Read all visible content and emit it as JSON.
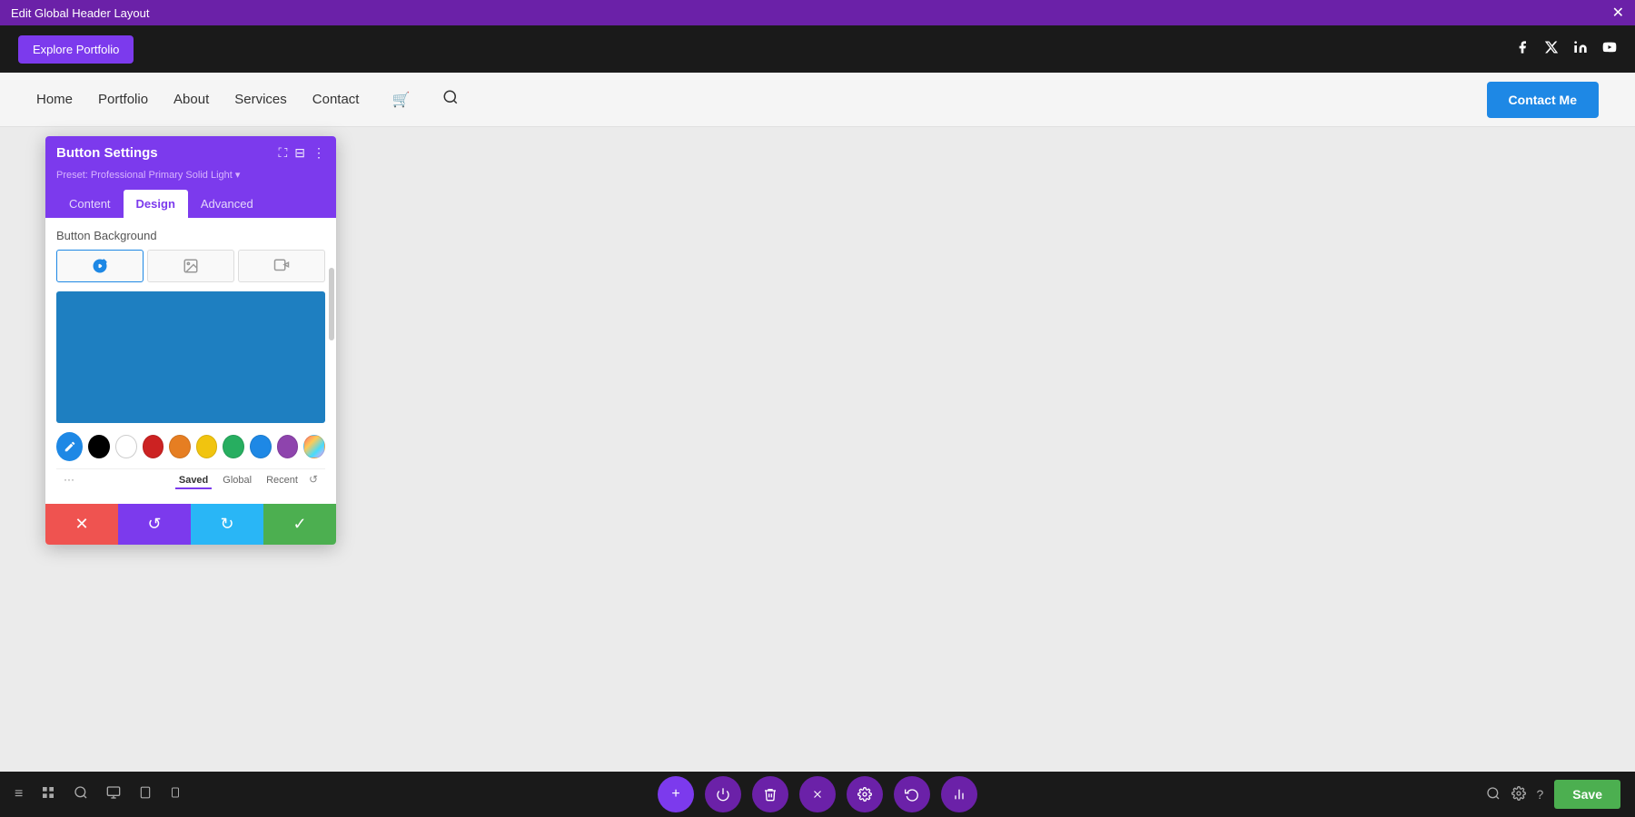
{
  "topBar": {
    "title": "Edit Global Header Layout",
    "closeIcon": "✕"
  },
  "header": {
    "exploreBtn": "Explore Portfolio",
    "socialIcons": [
      {
        "name": "facebook-icon",
        "symbol": "f"
      },
      {
        "name": "twitter-x-icon",
        "symbol": "𝕏"
      },
      {
        "name": "linkedin-icon",
        "symbol": "in"
      },
      {
        "name": "youtube-icon",
        "symbol": "▶"
      }
    ]
  },
  "nav": {
    "links": [
      "Home",
      "Portfolio",
      "About",
      "Services",
      "Contact"
    ],
    "contactBtn": "Contact Me"
  },
  "panel": {
    "title": "Button Settings",
    "preset": "Preset: Professional Primary Solid Light ▾",
    "tabs": [
      "Content",
      "Design",
      "Advanced"
    ],
    "activeTab": "Design",
    "bgLabel": "Button Background",
    "bgTypes": [
      {
        "icon": "🎨",
        "active": true
      },
      {
        "icon": "🖼",
        "active": false
      },
      {
        "icon": "📷",
        "active": false
      }
    ],
    "colorPreview": "#1e7fc1",
    "swatches": [
      {
        "color": "#000000"
      },
      {
        "color": "#ffffff"
      },
      {
        "color": "#cc2222"
      },
      {
        "color": "#e67e22"
      },
      {
        "color": "#f1c40f"
      },
      {
        "color": "#27ae60"
      },
      {
        "color": "#1e88e5"
      },
      {
        "color": "#8e44ad"
      }
    ],
    "footerTabs": [
      "Saved",
      "Global",
      "Recent"
    ],
    "actions": {
      "cancel": "✕",
      "undo": "↺",
      "redo": "↻",
      "confirm": "✓"
    }
  },
  "bottomToolbar": {
    "leftIcons": [
      "≡",
      "⊞",
      "🔍",
      "□",
      "◻",
      "▣"
    ],
    "centerBtns": [
      "+",
      "⏻",
      "🗑",
      "✕",
      "⚙",
      "⟳",
      "≣"
    ],
    "rightIcons": [
      "🔍",
      "⚙",
      "?"
    ],
    "saveBtn": "Save"
  }
}
